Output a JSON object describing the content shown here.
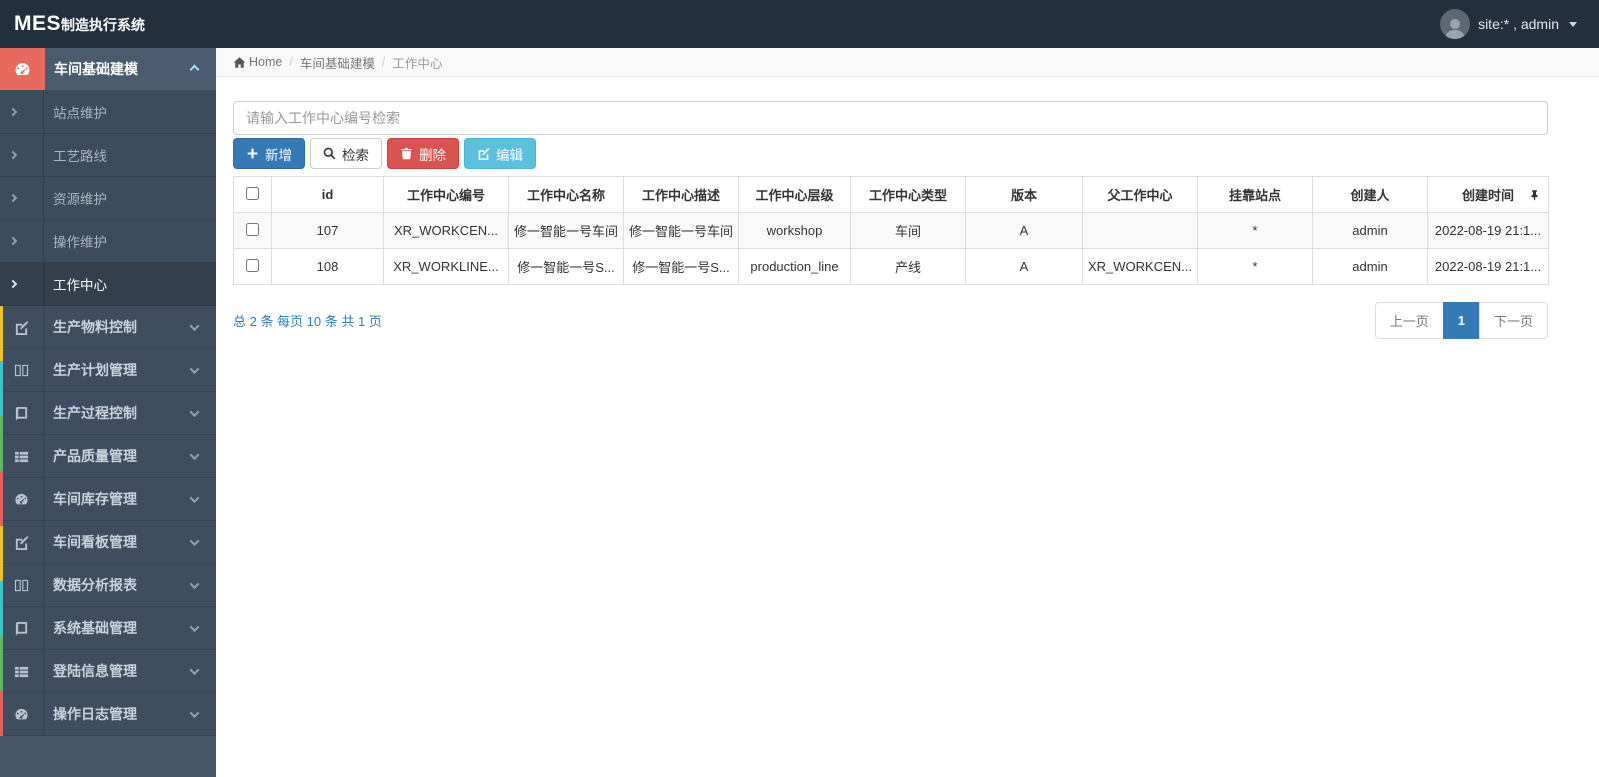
{
  "topbar": {
    "logo_bold": "MES",
    "logo_rest": "制造执行系统",
    "user_label": "site:* , admin"
  },
  "breadcrumb": {
    "home": "Home",
    "level1": "车间基础建模",
    "level2": "工作中心"
  },
  "sidebar": {
    "active_section": {
      "label": "车间基础建模",
      "icon": "dashboard-icon"
    },
    "submenu": [
      {
        "label": "站点维护"
      },
      {
        "label": "工艺路线"
      },
      {
        "label": "资源维护"
      },
      {
        "label": "操作维护"
      },
      {
        "label": "工作中心",
        "active": true
      }
    ],
    "sections": [
      {
        "label": "生产物料控制",
        "icon": "edit-icon"
      },
      {
        "label": "生产计划管理",
        "icon": "columns-icon"
      },
      {
        "label": "生产过程控制",
        "icon": "book-icon"
      },
      {
        "label": "产品质量管理",
        "icon": "list-icon"
      },
      {
        "label": "车间库存管理",
        "icon": "dashboard-icon"
      },
      {
        "label": "车间看板管理",
        "icon": "edit-icon"
      },
      {
        "label": "数据分析报表",
        "icon": "columns-icon"
      },
      {
        "label": "系统基础管理",
        "icon": "book-icon"
      },
      {
        "label": "登陆信息管理",
        "icon": "list-icon"
      },
      {
        "label": "操作日志管理",
        "icon": "dashboard-icon"
      }
    ]
  },
  "toolbar": {
    "search_placeholder": "请输入工作中心编号检索",
    "add_label": "新增",
    "search_label": "检索",
    "delete_label": "删除",
    "edit_label": "编辑"
  },
  "table": {
    "columns": [
      "id",
      "工作中心编号",
      "工作中心名称",
      "工作中心描述",
      "工作中心层级",
      "工作中心类型",
      "版本",
      "父工作中心",
      "挂靠站点",
      "创建人",
      "创建时间"
    ],
    "rows": [
      {
        "cells": [
          "107",
          "XR_WORKCEN...",
          "修一智能一号车间",
          "修一智能一号车间",
          "workshop",
          "车间",
          "A",
          "",
          "*",
          "admin",
          "2022-08-19 21:1..."
        ]
      },
      {
        "cells": [
          "108",
          "XR_WORKLINE...",
          "修一智能一号S...",
          "修一智能一号S...",
          "production_line",
          "产线",
          "A",
          "XR_WORKCEN...",
          "*",
          "admin",
          "2022-08-19 21:1..."
        ]
      }
    ]
  },
  "pagination": {
    "summary": "总 2 条 每页 10 条 共 1 页",
    "prev": "上一页",
    "current": "1",
    "next": "下一页"
  },
  "colors": {
    "topbar_bg": "#242f3e",
    "sidebar_bg": "#3e4e60",
    "sidebar_active_bg": "#4a5b6f",
    "sidebar_icon_accent": "#e8695e",
    "submenu_active_bg": "#333f4c",
    "primary": "#337ab7",
    "danger": "#d9534f",
    "info": "#5bc0de",
    "link": "#337ab7",
    "strip_colors": [
      "#edc32b",
      "#3ec2c5",
      "#5cb85c",
      "#e2625b"
    ]
  }
}
